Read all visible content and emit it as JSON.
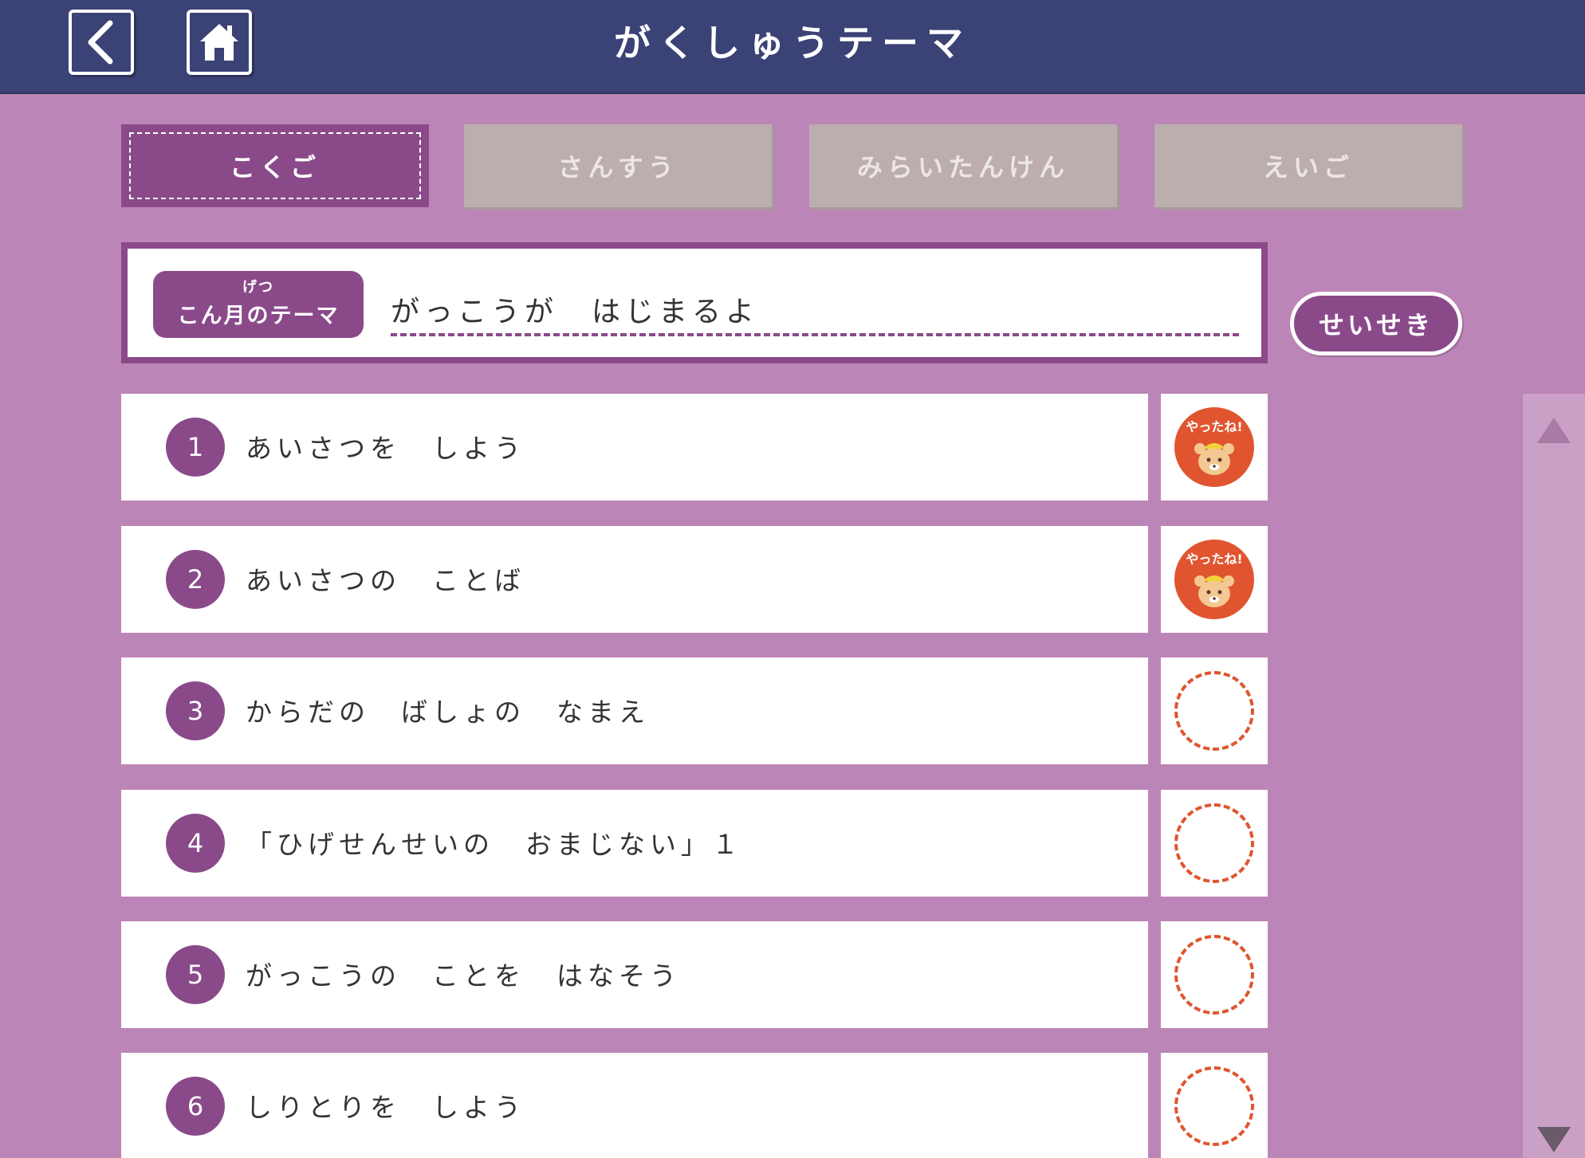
{
  "header": {
    "title": "がくしゅうテーマ",
    "back_icon": "back-arrow-icon",
    "home_icon": "home-icon"
  },
  "tabs": [
    {
      "label": "こくご",
      "active": true
    },
    {
      "label": "さんすう",
      "active": false
    },
    {
      "label": "みらいたんけん",
      "active": false
    },
    {
      "label": "えいご",
      "active": false
    }
  ],
  "theme": {
    "badge_ruby": "げつ",
    "badge_label": "こん月のテーマ",
    "text": "がっこうが　はじまるよ"
  },
  "seiseki_label": "せいせき",
  "lessons": [
    {
      "number": "1",
      "label": "あいさつを　しよう",
      "done": true
    },
    {
      "number": "2",
      "label": "あいさつの　ことば",
      "done": true
    },
    {
      "number": "3",
      "label": "からだの　ばしょの　なまえ",
      "done": false
    },
    {
      "number": "4",
      "label": "「ひげせんせいの　おまじない」１",
      "done": false
    },
    {
      "number": "5",
      "label": "がっこうの　ことを　はなそう",
      "done": false
    },
    {
      "number": "6",
      "label": "しりとりを　しよう",
      "done": false
    }
  ],
  "stamp": {
    "text": "やったね!",
    "icon": "bear-stamp-icon"
  },
  "colors": {
    "header": "#3a4276",
    "background": "#bc85b7",
    "accent": "#8a4a8a",
    "stamp": "#e0552f"
  }
}
